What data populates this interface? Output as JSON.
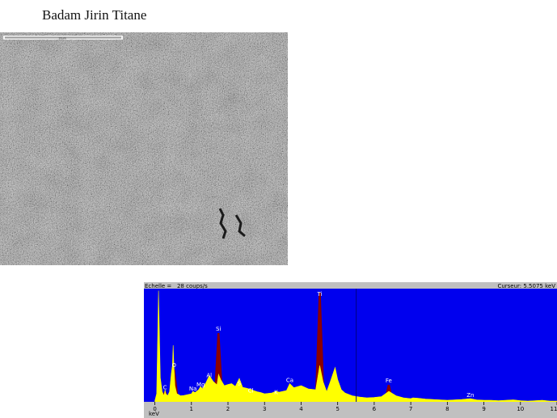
{
  "page": {
    "title": "Badam Jirin Titane"
  },
  "sem_image": {
    "scale_bar_label": "10µm"
  },
  "chart_data": {
    "type": "area",
    "header_left": "Echelle =   28 coups/s",
    "header_right": "Curseur: 5.5075 keV",
    "xlabel": "keV",
    "xlim": [
      -0.3,
      11
    ],
    "ylim": [
      0,
      28
    ],
    "x_ticks": [
      "0",
      "1",
      "2",
      "3",
      "4",
      "5",
      "6",
      "7",
      "8",
      "9",
      "10",
      "11"
    ],
    "cursor_kev": 5.5075,
    "colors": {
      "background": "#0000ee",
      "spectrum": "#ffff00",
      "peaks": "#8b0000",
      "labels": "#ffffff",
      "header_bar": "#c0c0c0"
    },
    "spectrum": {
      "x": [
        0.0,
        0.05,
        0.1,
        0.15,
        0.2,
        0.25,
        0.28,
        0.3,
        0.35,
        0.4,
        0.45,
        0.48,
        0.5,
        0.52,
        0.55,
        0.6,
        0.65,
        0.7,
        0.8,
        0.9,
        1.0,
        1.04,
        1.1,
        1.2,
        1.25,
        1.3,
        1.4,
        1.49,
        1.6,
        1.7,
        1.74,
        1.8,
        1.9,
        2.0,
        2.1,
        2.2,
        2.31,
        2.4,
        2.5,
        2.62,
        2.7,
        2.8,
        2.9,
        3.0,
        3.2,
        3.31,
        3.4,
        3.6,
        3.69,
        3.8,
        4.0,
        4.2,
        4.4,
        4.51,
        4.6,
        4.7,
        4.8,
        4.93,
        5.0,
        5.1,
        5.2,
        5.4,
        5.6,
        5.8,
        6.0,
        6.2,
        6.4,
        6.6,
        6.8,
        7.0,
        7.06,
        7.2,
        7.4,
        7.6,
        7.8,
        8.0,
        8.2,
        8.4,
        8.63,
        8.8,
        9.0,
        9.2,
        9.4,
        9.6,
        9.8,
        10.0,
        10.2,
        10.4,
        10.6,
        10.8,
        11.0
      ],
      "y": [
        0.3,
        2,
        27.5,
        6,
        2.5,
        1.5,
        3,
        2,
        1.5,
        2.5,
        7,
        9,
        14,
        9,
        4,
        2,
        1.8,
        1.5,
        1.6,
        1.8,
        2,
        2.6,
        2.3,
        3,
        3.8,
        3.2,
        4.8,
        6.5,
        5,
        4.2,
        6.8,
        5.5,
        4,
        4.3,
        4.5,
        3.8,
        5.8,
        3.6,
        3.4,
        3.1,
        2.8,
        2.5,
        2.3,
        2,
        2.2,
        2.6,
        2.4,
        2.8,
        4.5,
        3.5,
        4,
        3.2,
        3,
        9,
        5,
        2.5,
        5,
        8.5,
        5.5,
        3,
        2.2,
        1.5,
        1.2,
        1,
        1.1,
        1.3,
        2.6,
        1.5,
        1,
        0.8,
        1,
        0.9,
        0.7,
        0.6,
        0.5,
        0.4,
        0.5,
        0.6,
        0.8,
        0.5,
        0.4,
        0.4,
        0.3,
        0.4,
        0.5,
        0.3,
        0.2,
        0.3,
        0.4,
        0.2,
        0.2
      ]
    },
    "peaks": [
      {
        "label": "C",
        "kev": 0.277,
        "height": 2.5
      },
      {
        "label": "O",
        "kev": 0.525,
        "height": 8
      },
      {
        "label": "Na",
        "kev": 1.041,
        "height": 2.2
      },
      {
        "label": "Mg",
        "kev": 1.254,
        "height": 3.2
      },
      {
        "label": "Al",
        "kev": 1.486,
        "height": 5.5
      },
      {
        "label": "Si",
        "kev": 1.74,
        "height": 17
      },
      {
        "label": "S",
        "kev": 2.307,
        "height": 3.5
      },
      {
        "label": "Cl",
        "kev": 2.622,
        "height": 1.7
      },
      {
        "label": "K",
        "kev": 3.313,
        "height": 1.3
      },
      {
        "label": "Ca",
        "kev": 3.69,
        "height": 4.3
      },
      {
        "label": "Ti",
        "kev": 4.51,
        "height": 27
      },
      {
        "label": "Fe",
        "kev": 6.398,
        "height": 4.2
      },
      {
        "label": "Zn",
        "kev": 8.63,
        "height": 0.6
      }
    ]
  }
}
